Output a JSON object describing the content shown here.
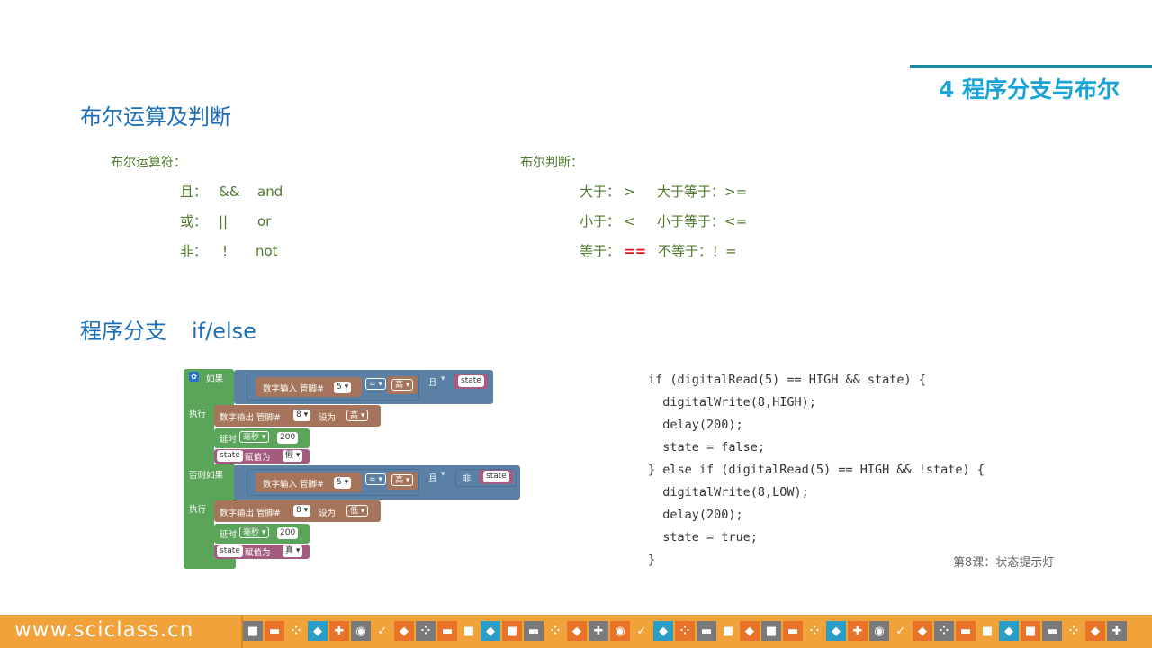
{
  "section_title": "4 程序分支与布尔",
  "bool_heading": "布尔运算及判断",
  "bool_ops": {
    "label": "布尔运算符：",
    "rows": [
      {
        "name": "且：",
        "symbol": "&&",
        "word": "and"
      },
      {
        "name": "或：",
        "symbol": "||",
        "word": "or"
      },
      {
        "name": "非：",
        "symbol": "!",
        "word": "not"
      }
    ]
  },
  "bool_judge": {
    "label": "布尔判断：",
    "rows": [
      {
        "a": "大于：",
        "a_sym": ">",
        "b": "大于等于：>="
      },
      {
        "a": "小于：",
        "a_sym": "<",
        "b": "小于等于：<="
      },
      {
        "a": "等于：",
        "a_sym": "==",
        "b": "不等于：！="
      }
    ]
  },
  "branch_heading": "程序分支",
  "branch_keyword": "if/else",
  "blocks": {
    "if": "如果",
    "then": "执行",
    "else_if": "否则如果",
    "digital_input": "数字输入 管脚#",
    "pin_in": "5",
    "eq": "=",
    "high": "高",
    "low": "低",
    "and": "且",
    "not": "非",
    "state": "state",
    "digital_output": "数字输出 管脚#",
    "pin_out": "8",
    "set_to": "设为",
    "delay": "延时",
    "ms": "毫秒",
    "delay_val": "200",
    "assign": "赋值为",
    "false": "假",
    "true": "真"
  },
  "code_lines": [
    "if (digitalRead(5) == HIGH && state) {",
    "  digitalWrite(8,HIGH);",
    "  delay(200);",
    "  state = false;",
    "} else if (digitalRead(5) == HIGH && !state) {",
    "  digitalWrite(8,LOW);",
    "  delay(200);",
    "  state = true;",
    "}"
  ],
  "lesson": "第8课：状态提示灯",
  "footer_url": "www.sciclass.cn",
  "colors": {
    "accent": "#1aa3d6",
    "heading": "#1c6fb8",
    "footer": "#f2a23a"
  }
}
